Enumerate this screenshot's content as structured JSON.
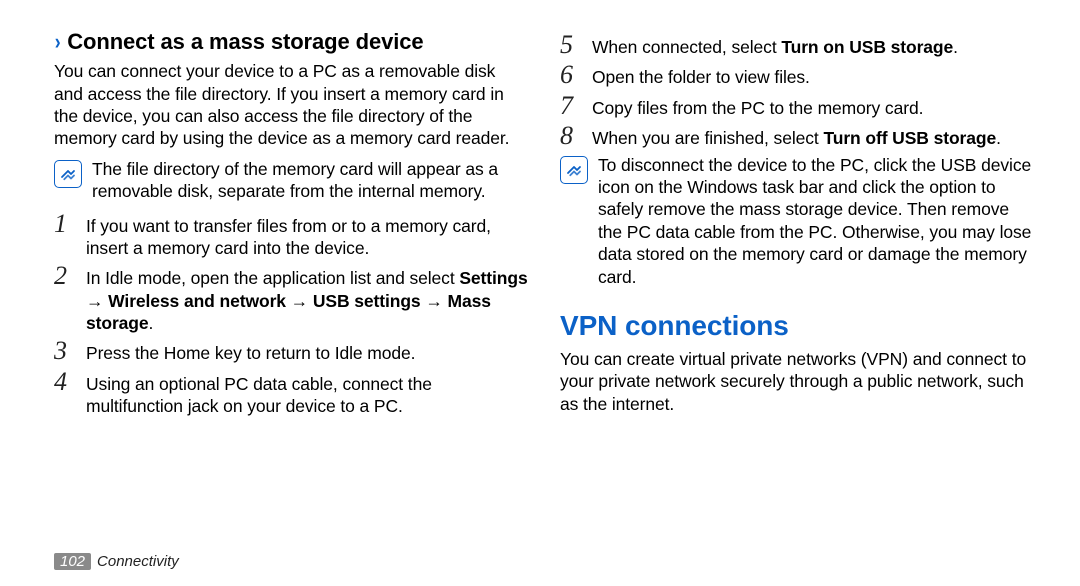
{
  "footer": {
    "page": "102",
    "chapter": "Connectivity"
  },
  "left": {
    "heading": "Connect as a mass storage device",
    "intro": "You can connect your device to a PC as a removable disk and access the file directory. If you insert a memory card in the device, you can also access the file directory of the memory card by using the device as a memory card reader.",
    "note": "The file directory of the memory card will appear as a removable disk, separate from the internal memory.",
    "steps": {
      "s1": {
        "num": "1",
        "text": "If you want to transfer files from or to a memory card, insert a memory card into the device."
      },
      "s2": {
        "num": "2",
        "pre": "In Idle mode, open the application list and select ",
        "bold": "Settings → Wireless and network → USB settings → Mass storage",
        "post": "."
      },
      "s3": {
        "num": "3",
        "text": "Press the Home key to return to Idle mode."
      },
      "s4": {
        "num": "4",
        "text": "Using an optional PC data cable, connect the multifunction jack on your device to a PC."
      }
    }
  },
  "right": {
    "steps": {
      "s5": {
        "num": "5",
        "pre": "When connected, select ",
        "bold": "Turn on USB storage",
        "post": "."
      },
      "s6": {
        "num": "6",
        "text": "Open the folder to view files."
      },
      "s7": {
        "num": "7",
        "text": "Copy files from the PC to the memory card."
      },
      "s8": {
        "num": "8",
        "pre": "When you are finished, select ",
        "bold": "Turn off USB storage",
        "post": "."
      }
    },
    "note": "To disconnect the device to the PC, click the USB device icon on the Windows task bar and click the option to safely remove the mass storage device. Then remove the PC data cable from the PC. Otherwise, you may lose data stored on the memory card or damage the memory card.",
    "section_title": "VPN connections",
    "section_intro": "You can create virtual private networks (VPN) and connect to your private network securely through a public network, such as the internet."
  }
}
